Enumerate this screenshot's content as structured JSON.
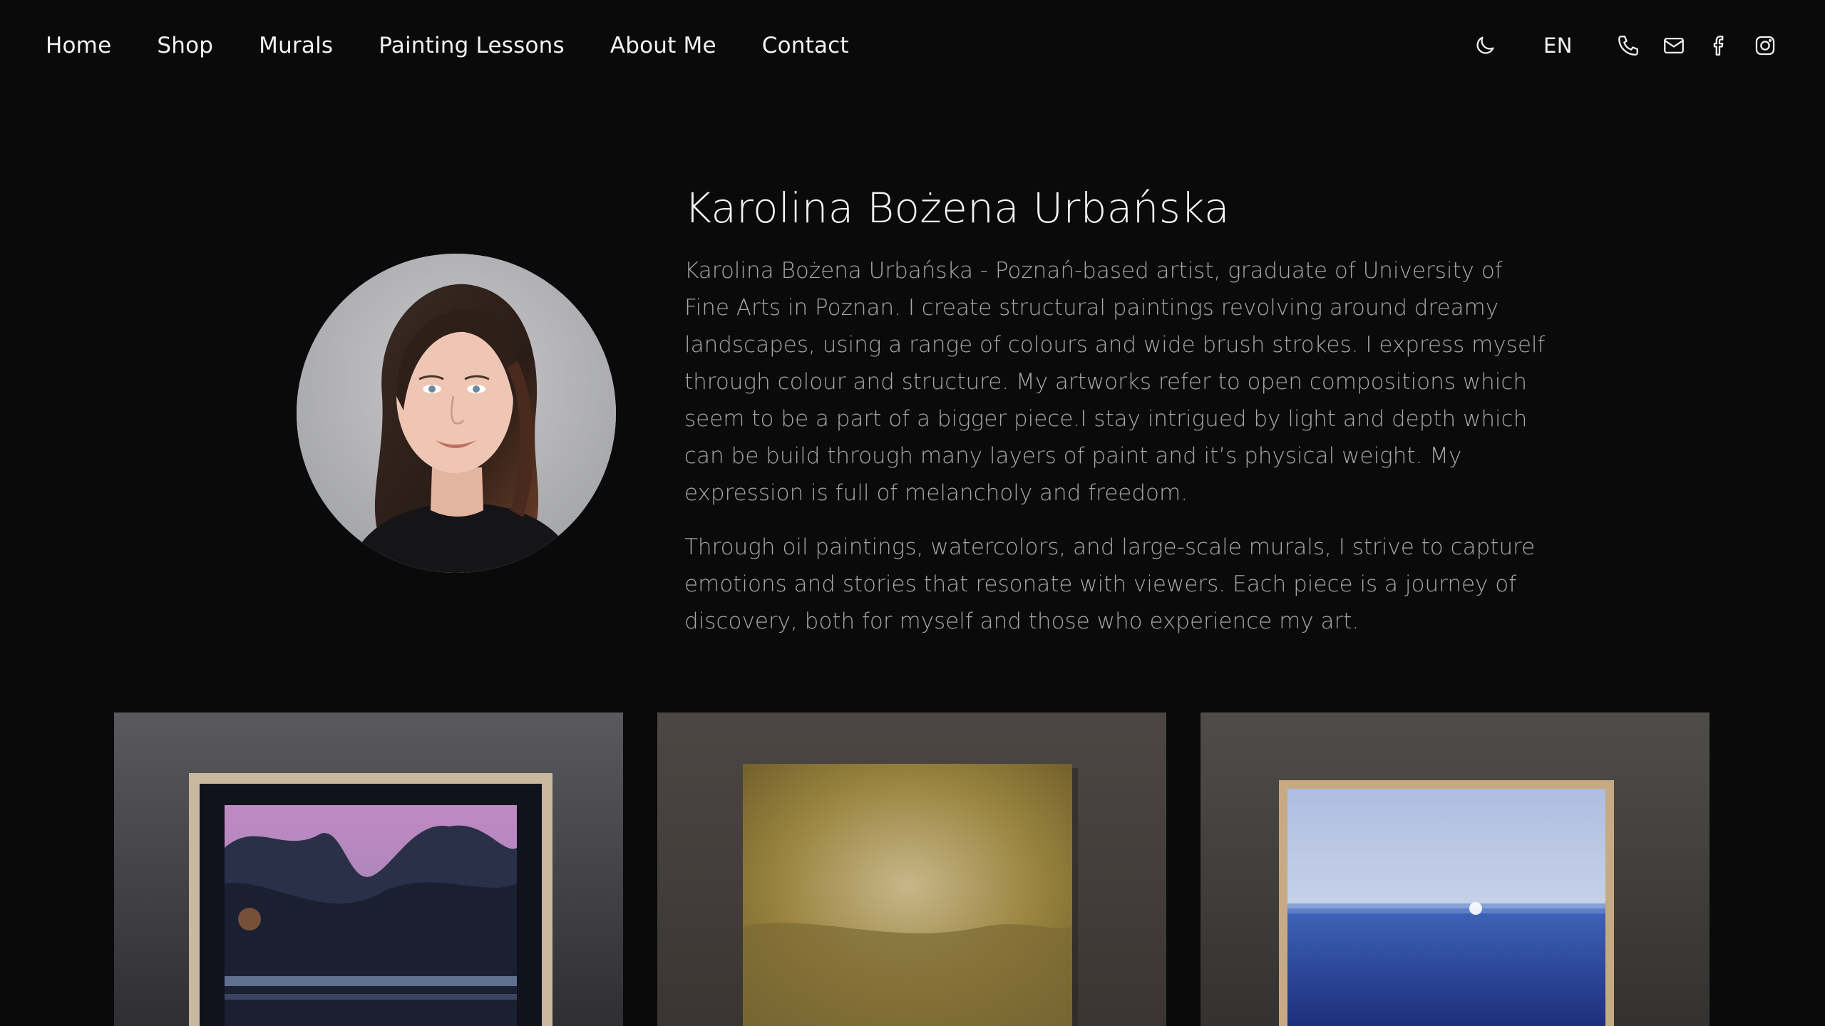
{
  "nav": {
    "links": [
      "Home",
      "Shop",
      "Murals",
      "Painting Lessons",
      "About Me",
      "Contact"
    ],
    "language": "EN",
    "icons": [
      "moon-icon",
      "phone-icon",
      "mail-icon",
      "facebook-icon",
      "instagram-icon"
    ]
  },
  "about": {
    "name": "Karolina Bożena Urbańska",
    "paragraph_1": "Karolina Bożena Urbańska - Poznań-based artist, graduate of University of Fine Arts in Poznan. I create structural paintings revolving around dreamy landscapes, using a range of colours and wide brush strokes. I express myself through colour and structure. My artworks refer to open compositions which seem to be a part of a bigger piece.I stay intrigued by light and depth which can be build through many layers of paint and it’s physical weight. My expression is full of melancholy and freedom.",
    "paragraph_2": "Through oil paintings, watercolors, and large-scale murals, I strive to capture emotions and stories that resonate with viewers. Each piece is a journey of discovery, both for myself and those who experience my art."
  },
  "colors": {
    "background": "#0a0a0b",
    "text_primary": "#f2f2f2",
    "text_muted": "#a7a7a9"
  }
}
